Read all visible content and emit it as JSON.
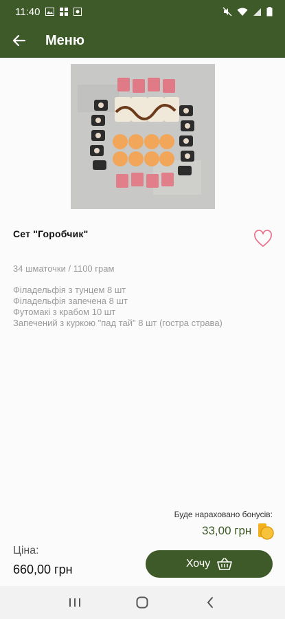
{
  "status_bar": {
    "time": "11:40"
  },
  "app_bar": {
    "title": "Меню",
    "back_icon": "arrow-left-icon"
  },
  "product": {
    "title": "Сет \"Горобчик\"",
    "weight": "34 шматочки / 1100 грам",
    "ingredients": [
      "Філадельфія з тунцем 8 шт",
      "Філадельфія запечена 8 шт",
      "Футомакі з крабом 10 шт",
      "Запечений з куркою \"пад тай\" 8 шт (гостра страва)"
    ]
  },
  "bonus": {
    "label": "Буде нараховано бонусів:",
    "value": "33,00 грн"
  },
  "price": {
    "label": "Ціна:",
    "value": "660,00 грн"
  },
  "actions": {
    "want_label": "Хочу"
  },
  "colors": {
    "primary": "#3e5a28",
    "heart": "#e8758f",
    "coin": "#f2b01e"
  }
}
